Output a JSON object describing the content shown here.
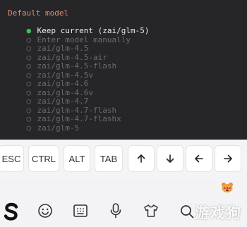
{
  "terminal": {
    "heading": "Default model",
    "options": [
      {
        "marker": "●",
        "label": "Keep current (zai/glm-5)",
        "selected": true
      },
      {
        "marker": "○",
        "label": "Enter model manually",
        "selected": false
      },
      {
        "marker": "○",
        "label": "zai/glm-4.5",
        "selected": false
      },
      {
        "marker": "○",
        "label": "zai/glm-4.5-air",
        "selected": false
      },
      {
        "marker": "○",
        "label": "zai/glm-4.5-flash",
        "selected": false
      },
      {
        "marker": "○",
        "label": "zai/glm-4.5v",
        "selected": false
      },
      {
        "marker": "○",
        "label": "zai/glm-4.6",
        "selected": false
      },
      {
        "marker": "○",
        "label": "zai/glm-4.6v",
        "selected": false
      },
      {
        "marker": "○",
        "label": "zai/glm-4.7",
        "selected": false
      },
      {
        "marker": "○",
        "label": "zai/glm-4.7-flash",
        "selected": false
      },
      {
        "marker": "○",
        "label": "zai/glm-4.7-flashx",
        "selected": false
      },
      {
        "marker": "○",
        "label": "zai/glm-5",
        "selected": false
      }
    ]
  },
  "extra_keys": {
    "esc": "ESC",
    "ctrl": "CTRL",
    "alt": "ALT",
    "tab": "TAB",
    "up": "up-arrow-icon",
    "down": "down-arrow-icon",
    "left": "left-arrow-icon",
    "right": "right-arrow-icon"
  },
  "keyboard_toolbar": {
    "icons": [
      "swiftkey-logo-icon",
      "emoji-icon",
      "clipboard-icon",
      "microphone-icon",
      "shirt-theme-icon",
      "search-icon",
      "bear-sticker-icon"
    ],
    "watermark": "游戏狗"
  },
  "colors": {
    "terminal_bg": "#262628",
    "heading": "#e08e72",
    "selected_marker": "#3bbf56",
    "selected_text": "#ececec",
    "option_text": "#6b6b6d"
  }
}
